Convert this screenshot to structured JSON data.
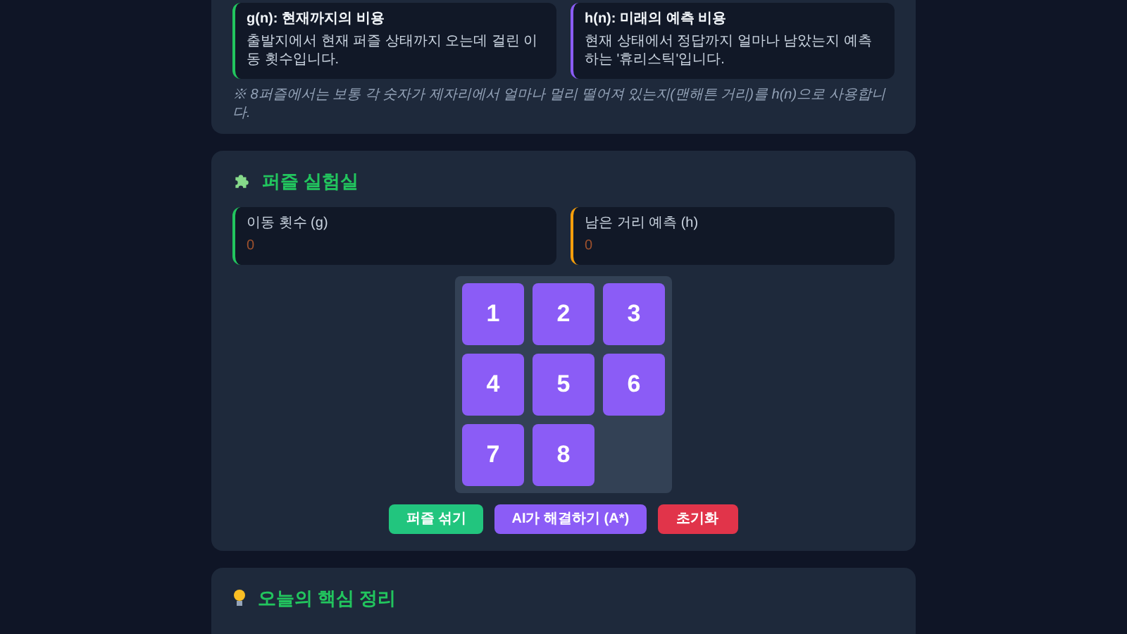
{
  "concepts": [
    {
      "title": "g(n): 현재까지의 비용",
      "text": "출발지에서 현재 퍼즐 상태까지 오는데 걸린 이동 횟수입니다.",
      "color": "#22c55e"
    },
    {
      "title": "h(n): 미래의 예측 비용",
      "text": "현재 상태에서 정답까지 얼마나 남았는지 예측하는 '휴리스틱'입니다.",
      "color": "#8b5cf6"
    }
  ],
  "note": "※ 8퍼즐에서는 보통 각 숫자가 제자리에서 얼마나 멀리 떨어져 있는지(맨해튼 거리)를 h(n)으로 사용합니다.",
  "lab": {
    "title": "퍼즐 실험실",
    "stats": [
      {
        "label": "이동 횟수 (g)",
        "value": "0",
        "color": "#22c55e"
      },
      {
        "label": "남은 거리 예측 (h)",
        "value": "0",
        "color": "#f59e0b"
      }
    ],
    "tiles": [
      {
        "kind": "tile",
        "label": "1"
      },
      {
        "kind": "tile",
        "label": "2"
      },
      {
        "kind": "tile",
        "label": "3"
      },
      {
        "kind": "tile",
        "label": "4"
      },
      {
        "kind": "tile",
        "label": "5"
      },
      {
        "kind": "tile",
        "label": "6"
      },
      {
        "kind": "tile",
        "label": "7"
      },
      {
        "kind": "tile",
        "label": "8"
      },
      {
        "kind": "blank"
      }
    ],
    "buttons": [
      {
        "label": "퍼즐 섞기",
        "color": "#22c57e"
      },
      {
        "label": "AI가 해결하기 (A*)",
        "color": "#8b5cf6"
      },
      {
        "label": "초기화",
        "color": "#e1344a"
      }
    ]
  },
  "summary": {
    "title": "오늘의 핵심 정리"
  }
}
